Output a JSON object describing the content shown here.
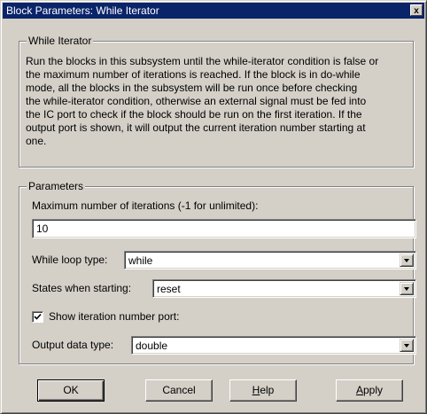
{
  "window": {
    "title": "Block Parameters: While Iterator",
    "close_label": "x"
  },
  "description": {
    "legend": "While Iterator",
    "text": "Run the blocks in this subsystem until the while-iterator condition is false or\nthe maximum number of iterations is reached.  If the block is in do-while\nmode, all the blocks in the subsystem will be run once before checking\nthe while-iterator condition, otherwise an external signal must be fed into\nthe IC port to check if the block should be run on the first iteration. If the\noutput port is shown, it will output the current iteration number starting at\none."
  },
  "parameters": {
    "legend": "Parameters",
    "max_iter_label": "Maximum number of iterations (-1 for unlimited):",
    "max_iter_value": "10",
    "loop_type_label": "While loop type:",
    "loop_type_value": "while",
    "states_label": "States when starting:",
    "states_value": "reset",
    "show_port_label": "Show iteration number port:",
    "show_port_checked": true,
    "output_type_label": "Output data type:",
    "output_type_value": "double"
  },
  "buttons": {
    "ok": "OK",
    "cancel": "Cancel",
    "help_first": "H",
    "help_rest": "elp",
    "apply_first": "A",
    "apply_rest": "pply"
  }
}
